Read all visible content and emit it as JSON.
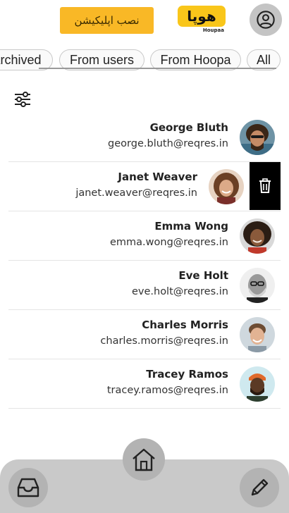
{
  "header": {
    "install_label": "نصب اپلیکیشن",
    "logo_text": "Houpaa",
    "logo_mark": "هوپا"
  },
  "tabs": [
    {
      "label": "Archived"
    },
    {
      "label": "From users"
    },
    {
      "label": "From Hoopa"
    },
    {
      "label": "All"
    }
  ],
  "users": [
    {
      "name": "George Bluth",
      "email": "george.bluth@reqres.in"
    },
    {
      "name": "Janet Weaver",
      "email": "janet.weaver@reqres.in"
    },
    {
      "name": "Emma Wong",
      "email": "emma.wong@reqres.in"
    },
    {
      "name": "Eve Holt",
      "email": "eve.holt@reqres.in"
    },
    {
      "name": "Charles Morris",
      "email": "charles.morris@reqres.in"
    },
    {
      "name": "Tracey Ramos",
      "email": "tracey.ramos@reqres.in"
    }
  ],
  "colors": {
    "accent": "#f9b826",
    "bar": "#c9c9c9",
    "button": "#b3b3b3",
    "delete": "#000000"
  },
  "icons": {
    "profile": "user-circle-icon",
    "filter": "sliders-icon",
    "delete": "trash-icon",
    "home": "home-icon",
    "inbox": "inbox-icon",
    "compose": "pencil-icon"
  }
}
